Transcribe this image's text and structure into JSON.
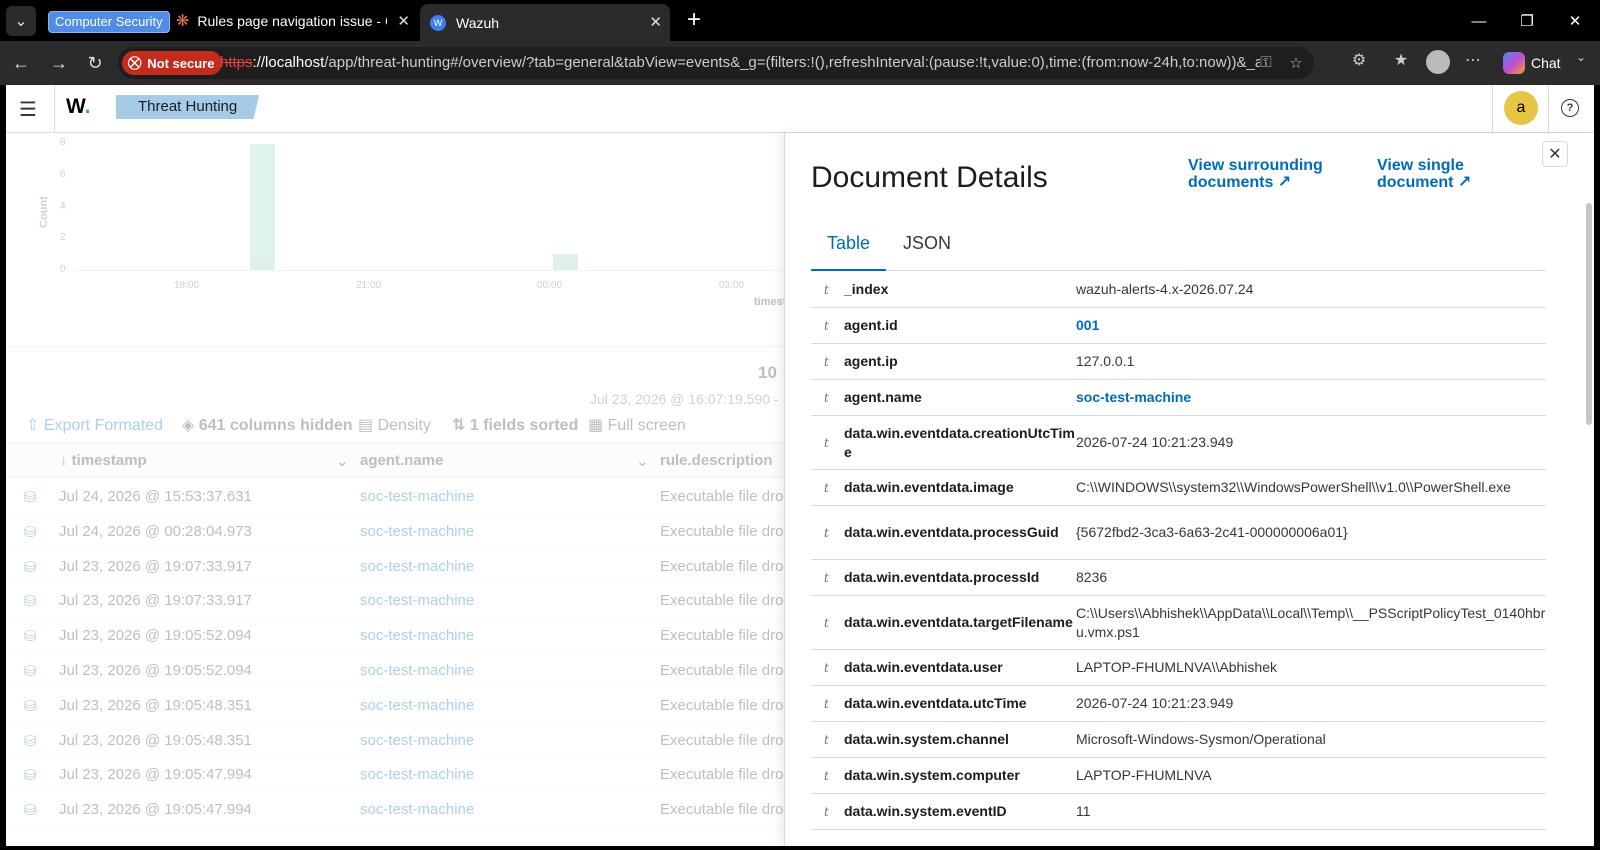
{
  "browser": {
    "tab_group": "Computer Security",
    "tabs": [
      {
        "title": "Rules page navigation issue - Claude"
      },
      {
        "title": "Wazuh"
      }
    ],
    "security_label": "Not secure",
    "url_scheme": "https",
    "url_host": "://localhost",
    "url_rest": "/app/threat-hunting#/overview/?tab=general&tabView=events&_g=(filters:!(),refreshInterval:(pause:!t,value:0),time:(from:now-24h,to:now))&_a=(...",
    "chat_label": "Chat"
  },
  "app": {
    "logo": "W",
    "breadcrumb": "Threat Hunting",
    "user_initial": "a"
  },
  "background": {
    "chart": {
      "y_ticks": [
        "8",
        "6",
        "4",
        "2",
        "0"
      ],
      "y_label": "Count",
      "x_ticks": [
        "18:00",
        "21:00",
        "00:00",
        "03:00"
      ],
      "x_label": "timestamp"
    },
    "hits_label": "10",
    "date_range": "Jul 23, 2026 @ 16:07:19.590 -",
    "toolbar": {
      "export": "Export Formated",
      "columns_hidden": "641 columns hidden",
      "density": "Density",
      "sorted": "1 fields sorted",
      "fullscreen": "Full screen"
    },
    "columns": [
      "timestamp",
      "agent.name",
      "rule.description"
    ],
    "rows": [
      {
        "timestamp": "Jul 24, 2026 @ 15:53:37.631",
        "agent": "soc-test-machine",
        "desc": "Executable file dro"
      },
      {
        "timestamp": "Jul 24, 2026 @ 00:28:04.973",
        "agent": "soc-test-machine",
        "desc": "Executable file dro"
      },
      {
        "timestamp": "Jul 23, 2026 @ 19:07:33.917",
        "agent": "soc-test-machine",
        "desc": "Executable file dro"
      },
      {
        "timestamp": "Jul 23, 2026 @ 19:07:33.917",
        "agent": "soc-test-machine",
        "desc": "Executable file dro"
      },
      {
        "timestamp": "Jul 23, 2026 @ 19:05:52.094",
        "agent": "soc-test-machine",
        "desc": "Executable file dro"
      },
      {
        "timestamp": "Jul 23, 2026 @ 19:05:52.094",
        "agent": "soc-test-machine",
        "desc": "Executable file dro"
      },
      {
        "timestamp": "Jul 23, 2026 @ 19:05:48.351",
        "agent": "soc-test-machine",
        "desc": "Executable file dro"
      },
      {
        "timestamp": "Jul 23, 2026 @ 19:05:48.351",
        "agent": "soc-test-machine",
        "desc": "Executable file dro"
      },
      {
        "timestamp": "Jul 23, 2026 @ 19:05:47.994",
        "agent": "soc-test-machine",
        "desc": "Executable file dro"
      },
      {
        "timestamp": "Jul 23, 2026 @ 19:05:47.994",
        "agent": "soc-test-machine",
        "desc": "Executable file dro"
      }
    ]
  },
  "flyout": {
    "title": "Document Details",
    "link_surrounding": "View surrounding\ndocuments",
    "link_single": "View single\ndocument",
    "tabs": [
      "Table",
      "JSON"
    ],
    "fields": [
      {
        "type": "t",
        "key": "_index",
        "value": "wazuh-alerts-4.x-2026.07.24",
        "link": false
      },
      {
        "type": "t",
        "key": "agent.id",
        "value": "001",
        "link": true
      },
      {
        "type": "t",
        "key": "agent.ip",
        "value": "127.0.0.1",
        "link": false
      },
      {
        "type": "t",
        "key": "agent.name",
        "value": "soc-test-machine",
        "link": true
      },
      {
        "type": "t",
        "key": "data.win.eventdata.creationUtcTime",
        "value": "2026-07-24 10:21:23.949",
        "link": false
      },
      {
        "type": "t",
        "key": "data.win.eventdata.image",
        "value": "C:\\\\WINDOWS\\\\system32\\\\WindowsPowerShell\\\\v1.0\\\\PowerShell.exe",
        "link": false
      },
      {
        "type": "t",
        "key": "data.win.eventdata.processGuid",
        "value": "{5672fbd2-3ca3-6a63-2c41-000000006a01}",
        "link": false
      },
      {
        "type": "t",
        "key": "data.win.eventdata.processId",
        "value": "8236",
        "link": false
      },
      {
        "type": "t",
        "key": "data.win.eventdata.targetFilename",
        "value": "C:\\\\Users\\\\Abhishek\\\\AppData\\\\Local\\\\Temp\\\\__PSScriptPolicyTest_0140hbru.vmx.ps1",
        "link": false
      },
      {
        "type": "t",
        "key": "data.win.eventdata.user",
        "value": "LAPTOP-FHUMLNVA\\\\Abhishek",
        "link": false
      },
      {
        "type": "t",
        "key": "data.win.eventdata.utcTime",
        "value": "2026-07-24 10:21:23.949",
        "link": false
      },
      {
        "type": "t",
        "key": "data.win.system.channel",
        "value": "Microsoft-Windows-Sysmon/Operational",
        "link": false
      },
      {
        "type": "t",
        "key": "data.win.system.computer",
        "value": "LAPTOP-FHUMLNVA",
        "link": false
      },
      {
        "type": "t",
        "key": "data.win.system.eventID",
        "value": "11",
        "link": false
      }
    ]
  }
}
